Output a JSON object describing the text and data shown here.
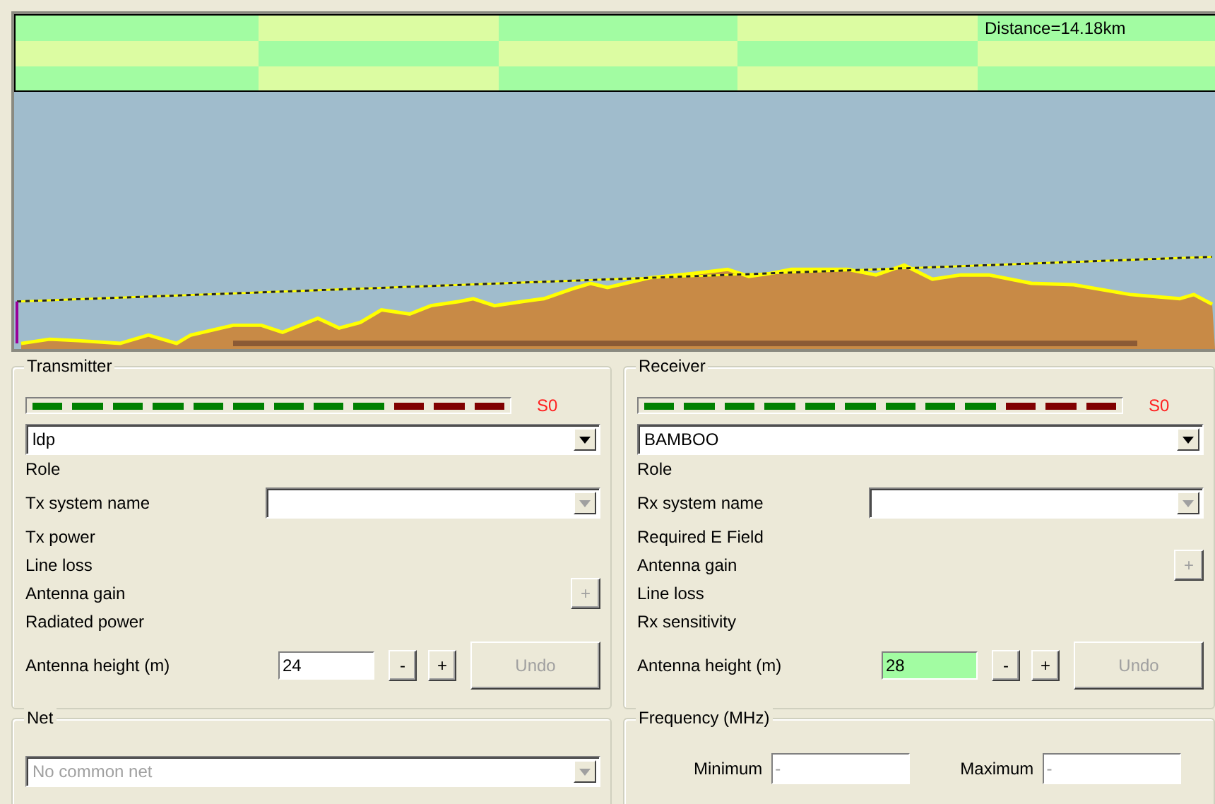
{
  "profile": {
    "distance_label": "Distance=14.18km"
  },
  "transmitter": {
    "title": "Transmitter",
    "meter_reading": "S0",
    "device": {
      "value": "ldp",
      "disabled": false
    },
    "rows": [
      {
        "kind": "label",
        "label": "Role"
      },
      {
        "kind": "combo",
        "label": "Tx system name",
        "disabled": true
      },
      {
        "kind": "label",
        "label": "Tx power"
      },
      {
        "kind": "label",
        "label": "Line loss"
      },
      {
        "kind": "button",
        "label": "Antenna gain",
        "button": "+",
        "disabled": true
      },
      {
        "kind": "label",
        "label": "Radiated power"
      }
    ],
    "height": {
      "label": "Antenna height (m)",
      "value": "24",
      "highlighted": false,
      "minus": "-",
      "plus": "+",
      "undo": "Undo",
      "undo_disabled": true
    }
  },
  "receiver": {
    "title": "Receiver",
    "meter_reading": "S0",
    "device": {
      "value": "BAMBOO",
      "disabled": false
    },
    "rows": [
      {
        "kind": "label",
        "label": "Role"
      },
      {
        "kind": "combo",
        "label": "Rx system name",
        "disabled": true
      },
      {
        "kind": "label",
        "label": "Required E Field"
      },
      {
        "kind": "button",
        "label": "Antenna gain",
        "button": "+",
        "disabled": true
      },
      {
        "kind": "label",
        "label": "Line loss"
      },
      {
        "kind": "label",
        "label": "Rx sensitivity"
      }
    ],
    "height": {
      "label": "Antenna height (m)",
      "value": "28",
      "highlighted": true,
      "minus": "-",
      "plus": "+",
      "undo": "Undo",
      "undo_disabled": true
    }
  },
  "net": {
    "title": "Net",
    "combo": {
      "value": "No common net",
      "disabled": true
    }
  },
  "frequency": {
    "title": "Frequency (MHz)",
    "fields": [
      {
        "label": "Minimum",
        "placeholder": "-"
      },
      {
        "label": "Maximum",
        "placeholder": "-"
      }
    ]
  }
}
